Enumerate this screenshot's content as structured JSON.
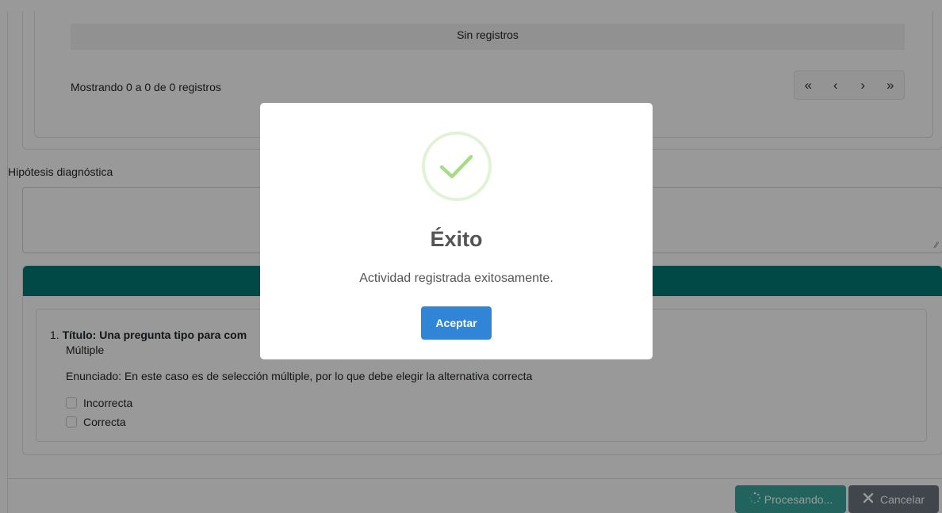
{
  "table": {
    "empty_message": "Sin registros",
    "info": "Mostrando 0 a 0 de 0 registros",
    "pager": {
      "first": "«",
      "prev": "‹",
      "next": "›",
      "last": "»"
    }
  },
  "hypothesis": {
    "label": "Hipótesis diagnóstica",
    "value": ""
  },
  "question": {
    "number": "1.",
    "title": "Título: Una pregunta tipo para com",
    "type": "Múltiple",
    "statement": "Enunciado: En este caso es de selección múltiple, por lo que debe elegir la alternativa correcta",
    "options": [
      "Incorrecta",
      "Correcta"
    ]
  },
  "footer": {
    "processing_label": "Procesando...",
    "cancel_label": "Cancelar"
  },
  "modal": {
    "icon": "success-check-icon",
    "title": "Éxito",
    "message": "Actividad registrada exitosamente.",
    "confirm_label": "Aceptar"
  },
  "colors": {
    "header_teal": "#007b76",
    "processing_button": "#3aa79b",
    "cancel_button": "#6c757d",
    "confirm_button": "#3085d6",
    "success_green": "#a5dc86"
  }
}
